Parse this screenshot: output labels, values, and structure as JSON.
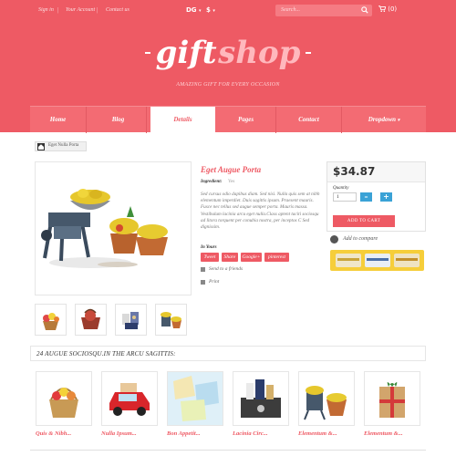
{
  "topbar": {
    "sign_in": "Sign in",
    "account": "Your Account",
    "contact": "Contact us",
    "sep": "|",
    "language": "DG",
    "currency": "$",
    "search_placeholder": "Search...",
    "cart": "(0)"
  },
  "logo": {
    "gift": "gift",
    "shop": "shop"
  },
  "tagline": "AMAZING GIFT FOR EVERY OCCASION",
  "nav": [
    "Home",
    "Blog",
    "Details",
    "Pages",
    "Contact",
    "Dropdown"
  ],
  "breadcrumb": "Eget Nulla Porta",
  "product": {
    "title": "Eget Augue Porta",
    "label_ingredient": "Ingredient:",
    "ingredient_value": "Yes",
    "description": "Sed cursus odio dapibus diam. Sed nisi. Nulla quis sem at nibh elementum imperdiet. Duis sagittis ipsum. Praesent mauris. Fusce nec tellus sed augue semper porta. Mauris massa. Vestibulum lacinia arcu eget nulla.Class aptent taciti sociosqu ad litora torquent per conubia nostra, per inceptos C Sed dignissim.",
    "tags_label": "In Yours",
    "tags": [
      "Tweet",
      "Share",
      "Google+",
      "pinterest"
    ],
    "send": "Send to a friends",
    "print": "Print"
  },
  "buy": {
    "price": "$34.87",
    "qty_label": "Quantity",
    "qty_value": "1",
    "minus": "–",
    "plus": "+",
    "add_to_cart": "ADD TO CART",
    "compare": "Add to compare"
  },
  "related": {
    "title": "24 AUGUE SOCIOSQU.IN THE ARCU SAGITTIS:",
    "items": [
      "Quis & Nibh...",
      "Nulla Ipsum...",
      "Bon Appetit...",
      "Lacinia Circ...",
      "Elementum &...",
      "Elementum &..."
    ]
  },
  "colors": {
    "brand": "#ee5a64",
    "accent_blue": "#3aa2d6",
    "pay_yellow": "#f6ce3a"
  }
}
